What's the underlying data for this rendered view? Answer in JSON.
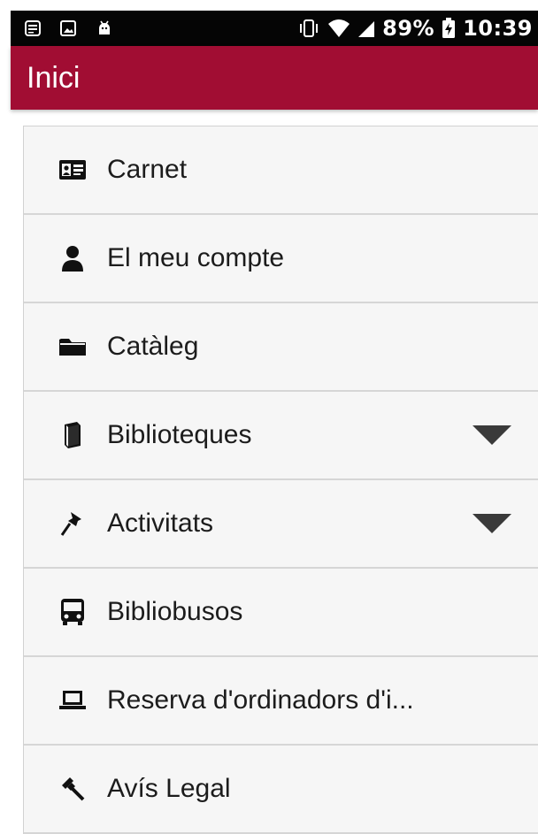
{
  "status_bar": {
    "battery": "89%",
    "time": "10:39",
    "icons": [
      "notification-list-icon",
      "image-icon",
      "android-icon",
      "vibrate-icon",
      "wifi-icon",
      "signal-icon",
      "battery-charging-icon"
    ]
  },
  "app_bar": {
    "title": "Inici",
    "color": "#a10d33"
  },
  "menu": {
    "items": [
      {
        "label": "Carnet",
        "icon": "id-card-icon",
        "expandable": false
      },
      {
        "label": "El meu compte",
        "icon": "user-icon",
        "expandable": false
      },
      {
        "label": "Catàleg",
        "icon": "folder-icon",
        "expandable": false
      },
      {
        "label": "Biblioteques",
        "icon": "book-icon",
        "expandable": true
      },
      {
        "label": "Activitats",
        "icon": "pushpin-icon",
        "expandable": true
      },
      {
        "label": "Bibliobusos",
        "icon": "bus-icon",
        "expandable": false
      },
      {
        "label": "Reserva d'ordinadors d'i...",
        "icon": "laptop-icon",
        "expandable": false
      },
      {
        "label": "Avís Legal",
        "icon": "gavel-icon",
        "expandable": false
      }
    ]
  }
}
